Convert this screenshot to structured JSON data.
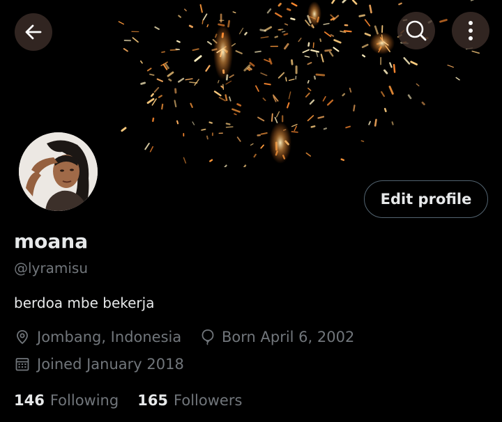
{
  "profile": {
    "name": "moana",
    "handle": "@lyramisu",
    "bio": "berdoa mbe bekerja",
    "location": "Jombang, Indonesia",
    "birth": "Born April 6, 2002",
    "joined": "Joined January 2018",
    "edit_label": "Edit profile"
  },
  "stats": {
    "following_count": "146",
    "following_label": "Following",
    "followers_count": "165",
    "followers_label": "Followers"
  },
  "icons": {
    "back": "arrow-left-icon",
    "search": "search-icon",
    "more": "more-vertical-icon",
    "location": "location-pin-icon",
    "birth": "balloon-icon",
    "joined": "calendar-icon"
  },
  "colors": {
    "background": "#000000",
    "text_primary": "#e7e9ea",
    "text_secondary": "#71767b",
    "button_border": "#536471",
    "spark": "#ffb060"
  }
}
